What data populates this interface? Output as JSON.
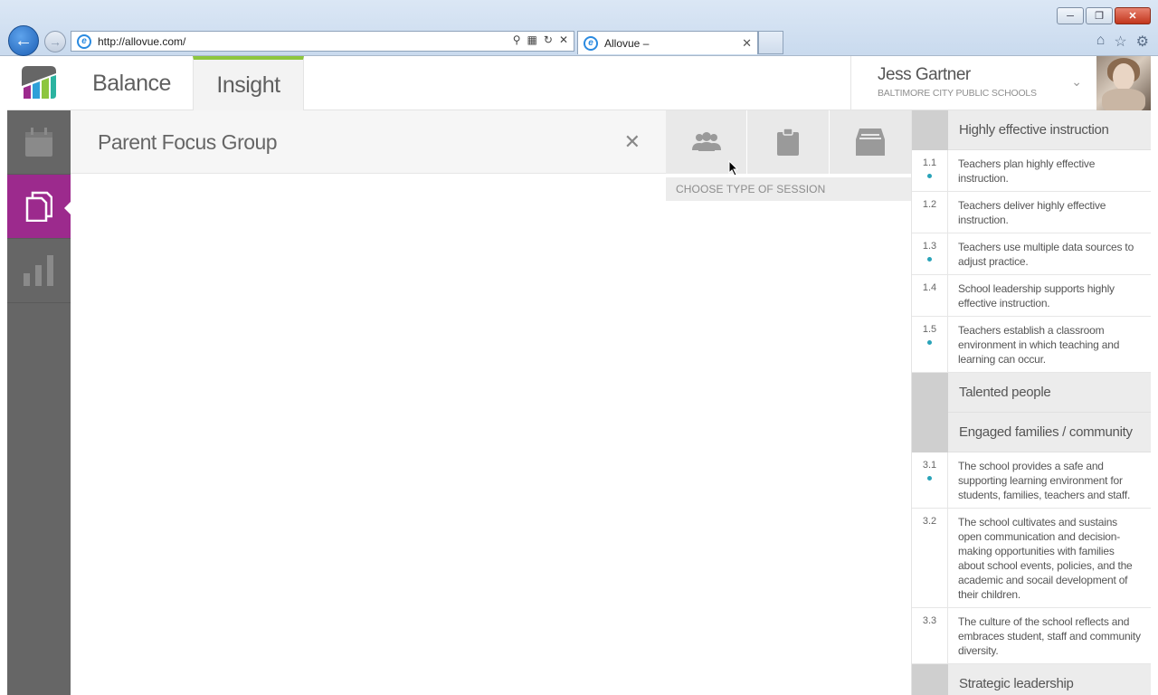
{
  "browser": {
    "url": "http://allovue.com/",
    "tab_title": "Allovue –",
    "window_buttons": [
      "minimize",
      "restore",
      "close"
    ]
  },
  "app": {
    "nav": [
      {
        "label": "Balance",
        "active": false
      },
      {
        "label": "Insight",
        "active": true
      }
    ],
    "accent_color": "#9c2a8d",
    "insight_accent": "#8dc63f",
    "user": {
      "name": "Jess Gartner",
      "organization": "BALTIMORE CITY PUBLIC SCHOOLS"
    }
  },
  "sidebar": {
    "items": [
      {
        "icon": "calendar-icon",
        "active": false
      },
      {
        "icon": "documents-icon",
        "active": true
      },
      {
        "icon": "bar-chart-icon",
        "active": false
      }
    ]
  },
  "form": {
    "title": "Parent Focus Group",
    "session_types": [
      {
        "icon": "group-icon"
      },
      {
        "icon": "clipboard-icon"
      },
      {
        "icon": "inbox-icon"
      }
    ],
    "session_prompt": "CHOOSE TYPE OF SESSION"
  },
  "standards": {
    "cat1": {
      "label": "Highly effective instruction"
    },
    "cat2": {
      "label": "Talented people"
    },
    "cat3": {
      "label": "Engaged families / community"
    },
    "cat4": {
      "label": "Strategic leadership"
    },
    "items": {
      "s11": {
        "num": "1.1",
        "text": "Teachers plan highly effective instruction.",
        "marked": true
      },
      "s12": {
        "num": "1.2",
        "text": "Teachers deliver highly effective instruction.",
        "marked": false
      },
      "s13": {
        "num": "1.3",
        "text": "Teachers use multiple data sources to adjust practice.",
        "marked": true
      },
      "s14": {
        "num": "1.4",
        "text": "School leadership supports highly effective instruction.",
        "marked": false
      },
      "s15": {
        "num": "1.5",
        "text": "Teachers establish a classroom environment in which teaching and learning can occur.",
        "marked": true
      },
      "s31": {
        "num": "3.1",
        "text": "The school provides a safe and supporting learning environment for students, families, teachers and staff.",
        "marked": true
      },
      "s32": {
        "num": "3.2",
        "text": "The school cultivates and sustains open communication and decision-making opportunities with families about school events, policies, and the academic and socail development of their children.",
        "marked": false
      },
      "s33": {
        "num": "3.3",
        "text": "The culture of the school reflects and embraces student, staff and community diversity.",
        "marked": false
      }
    }
  }
}
